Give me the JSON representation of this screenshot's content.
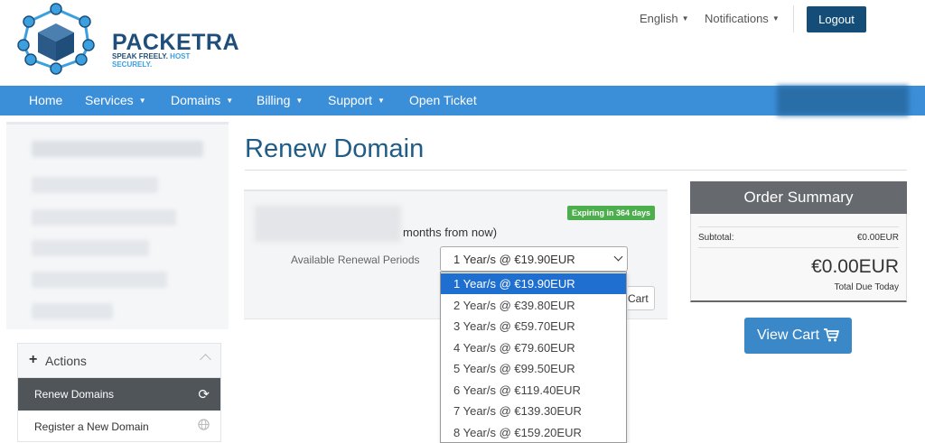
{
  "header": {
    "brand": "PACKETRA",
    "tagline_part1": "SPEAK FREELY. ",
    "tagline_part2": "HOST SECURELY.",
    "language": "English",
    "notifications": "Notifications",
    "logout": "Logout"
  },
  "nav": {
    "items": [
      {
        "label": "Home"
      },
      {
        "label": "Services"
      },
      {
        "label": "Domains"
      },
      {
        "label": "Billing"
      },
      {
        "label": "Support"
      },
      {
        "label": "Open Ticket"
      }
    ]
  },
  "sidebar": {
    "actions_title": "Actions",
    "items": [
      {
        "label": "Renew Domains",
        "icon": "refresh-icon"
      },
      {
        "label": "Register a New Domain",
        "icon": "globe-icon"
      }
    ]
  },
  "main": {
    "title": "Renew Domain",
    "months_text": "months from now)",
    "badge": "Expiring in 364 days",
    "renewal_label": "Available Renewal Periods",
    "selected_period": "1 Year/s @ €19.90EUR",
    "cart_partial": "Cart",
    "options": [
      "1 Year/s @ €19.90EUR",
      "2 Year/s @ €39.80EUR",
      "3 Year/s @ €59.70EUR",
      "4 Year/s @ €79.60EUR",
      "5 Year/s @ €99.50EUR",
      "6 Year/s @ €119.40EUR",
      "7 Year/s @ €139.30EUR",
      "8 Year/s @ €159.20EUR"
    ]
  },
  "summary": {
    "title": "Order Summary",
    "subtotal_label": "Subtotal:",
    "subtotal_value": "€0.00EUR",
    "total": "€0.00EUR",
    "total_label": "Total Due Today",
    "view_cart": "View Cart"
  },
  "colors": {
    "brand_blue": "#1f4e7a",
    "nav_blue": "#3b8fd9",
    "logout_bg": "#144d77",
    "badge_green": "#4cae4c",
    "selected_option": "#1f6fd0"
  }
}
